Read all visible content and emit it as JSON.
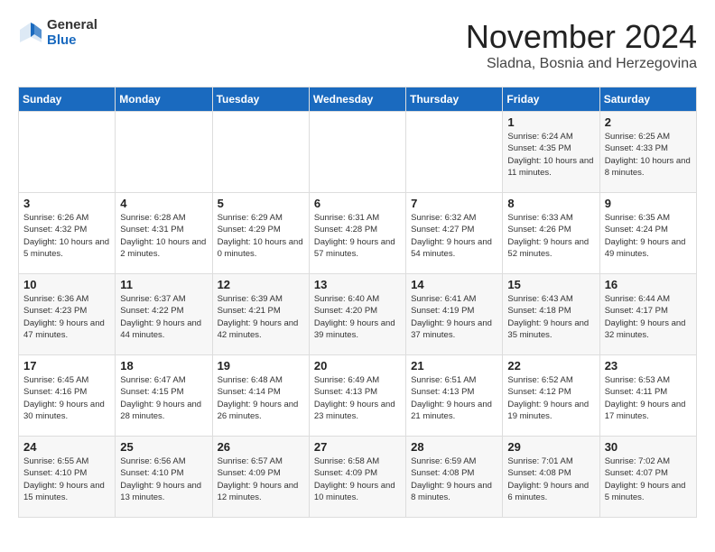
{
  "logo": {
    "general": "General",
    "blue": "Blue"
  },
  "title": "November 2024",
  "location": "Sladna, Bosnia and Herzegovina",
  "days_header": [
    "Sunday",
    "Monday",
    "Tuesday",
    "Wednesday",
    "Thursday",
    "Friday",
    "Saturday"
  ],
  "weeks": [
    [
      {
        "day": "",
        "info": ""
      },
      {
        "day": "",
        "info": ""
      },
      {
        "day": "",
        "info": ""
      },
      {
        "day": "",
        "info": ""
      },
      {
        "day": "",
        "info": ""
      },
      {
        "day": "1",
        "info": "Sunrise: 6:24 AM\nSunset: 4:35 PM\nDaylight: 10 hours and 11 minutes."
      },
      {
        "day": "2",
        "info": "Sunrise: 6:25 AM\nSunset: 4:33 PM\nDaylight: 10 hours and 8 minutes."
      }
    ],
    [
      {
        "day": "3",
        "info": "Sunrise: 6:26 AM\nSunset: 4:32 PM\nDaylight: 10 hours and 5 minutes."
      },
      {
        "day": "4",
        "info": "Sunrise: 6:28 AM\nSunset: 4:31 PM\nDaylight: 10 hours and 2 minutes."
      },
      {
        "day": "5",
        "info": "Sunrise: 6:29 AM\nSunset: 4:29 PM\nDaylight: 10 hours and 0 minutes."
      },
      {
        "day": "6",
        "info": "Sunrise: 6:31 AM\nSunset: 4:28 PM\nDaylight: 9 hours and 57 minutes."
      },
      {
        "day": "7",
        "info": "Sunrise: 6:32 AM\nSunset: 4:27 PM\nDaylight: 9 hours and 54 minutes."
      },
      {
        "day": "8",
        "info": "Sunrise: 6:33 AM\nSunset: 4:26 PM\nDaylight: 9 hours and 52 minutes."
      },
      {
        "day": "9",
        "info": "Sunrise: 6:35 AM\nSunset: 4:24 PM\nDaylight: 9 hours and 49 minutes."
      }
    ],
    [
      {
        "day": "10",
        "info": "Sunrise: 6:36 AM\nSunset: 4:23 PM\nDaylight: 9 hours and 47 minutes."
      },
      {
        "day": "11",
        "info": "Sunrise: 6:37 AM\nSunset: 4:22 PM\nDaylight: 9 hours and 44 minutes."
      },
      {
        "day": "12",
        "info": "Sunrise: 6:39 AM\nSunset: 4:21 PM\nDaylight: 9 hours and 42 minutes."
      },
      {
        "day": "13",
        "info": "Sunrise: 6:40 AM\nSunset: 4:20 PM\nDaylight: 9 hours and 39 minutes."
      },
      {
        "day": "14",
        "info": "Sunrise: 6:41 AM\nSunset: 4:19 PM\nDaylight: 9 hours and 37 minutes."
      },
      {
        "day": "15",
        "info": "Sunrise: 6:43 AM\nSunset: 4:18 PM\nDaylight: 9 hours and 35 minutes."
      },
      {
        "day": "16",
        "info": "Sunrise: 6:44 AM\nSunset: 4:17 PM\nDaylight: 9 hours and 32 minutes."
      }
    ],
    [
      {
        "day": "17",
        "info": "Sunrise: 6:45 AM\nSunset: 4:16 PM\nDaylight: 9 hours and 30 minutes."
      },
      {
        "day": "18",
        "info": "Sunrise: 6:47 AM\nSunset: 4:15 PM\nDaylight: 9 hours and 28 minutes."
      },
      {
        "day": "19",
        "info": "Sunrise: 6:48 AM\nSunset: 4:14 PM\nDaylight: 9 hours and 26 minutes."
      },
      {
        "day": "20",
        "info": "Sunrise: 6:49 AM\nSunset: 4:13 PM\nDaylight: 9 hours and 23 minutes."
      },
      {
        "day": "21",
        "info": "Sunrise: 6:51 AM\nSunset: 4:13 PM\nDaylight: 9 hours and 21 minutes."
      },
      {
        "day": "22",
        "info": "Sunrise: 6:52 AM\nSunset: 4:12 PM\nDaylight: 9 hours and 19 minutes."
      },
      {
        "day": "23",
        "info": "Sunrise: 6:53 AM\nSunset: 4:11 PM\nDaylight: 9 hours and 17 minutes."
      }
    ],
    [
      {
        "day": "24",
        "info": "Sunrise: 6:55 AM\nSunset: 4:10 PM\nDaylight: 9 hours and 15 minutes."
      },
      {
        "day": "25",
        "info": "Sunrise: 6:56 AM\nSunset: 4:10 PM\nDaylight: 9 hours and 13 minutes."
      },
      {
        "day": "26",
        "info": "Sunrise: 6:57 AM\nSunset: 4:09 PM\nDaylight: 9 hours and 12 minutes."
      },
      {
        "day": "27",
        "info": "Sunrise: 6:58 AM\nSunset: 4:09 PM\nDaylight: 9 hours and 10 minutes."
      },
      {
        "day": "28",
        "info": "Sunrise: 6:59 AM\nSunset: 4:08 PM\nDaylight: 9 hours and 8 minutes."
      },
      {
        "day": "29",
        "info": "Sunrise: 7:01 AM\nSunset: 4:08 PM\nDaylight: 9 hours and 6 minutes."
      },
      {
        "day": "30",
        "info": "Sunrise: 7:02 AM\nSunset: 4:07 PM\nDaylight: 9 hours and 5 minutes."
      }
    ]
  ]
}
